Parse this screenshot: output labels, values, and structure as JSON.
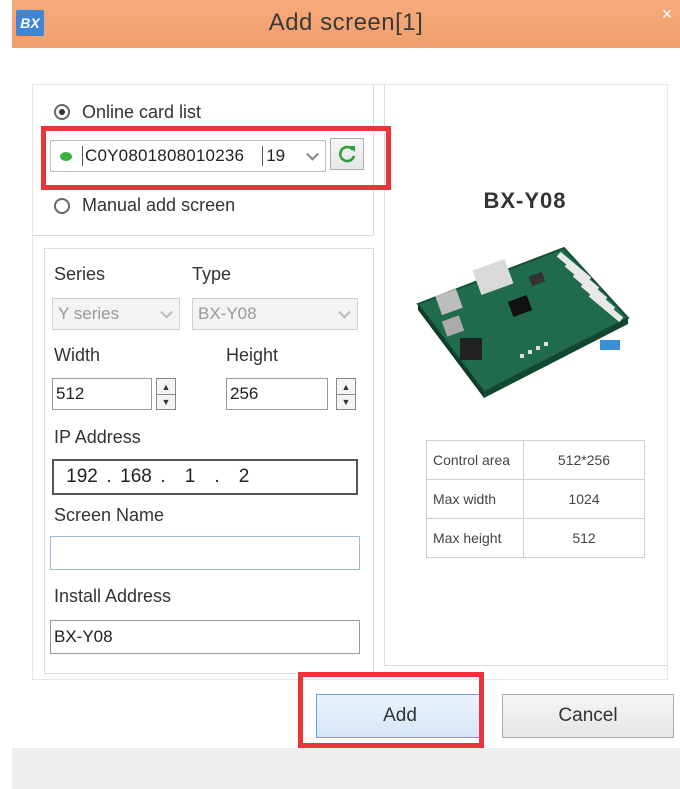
{
  "window": {
    "title": "Add screen[1]",
    "logo_text": "BX",
    "close_glyph": "×",
    "accent_color": "#f09e6d"
  },
  "card_source": {
    "online_label": "Online card list",
    "online_selected": true,
    "card_status_color": "#3cb043",
    "card_id": "C0Y0801808010236",
    "card_suffix": "19",
    "refresh_icon": "refresh-icon",
    "manual_label": "Manual add screen"
  },
  "config": {
    "series_label": "Series",
    "series_value": "Y series",
    "type_label": "Type",
    "type_value": "BX-Y08",
    "width_label": "Width",
    "width_value": "512",
    "height_label": "Height",
    "height_value": "256",
    "ip_label": "IP Address",
    "ip_octets": [
      "192",
      "168",
      "1",
      "2"
    ],
    "screen_name_label": "Screen Name",
    "screen_name_value": "",
    "install_address_label": "Install Address",
    "install_address_value": "BX-Y08"
  },
  "preview": {
    "model": "BX-Y08",
    "specs": [
      {
        "key": "Control area",
        "value": "512*256"
      },
      {
        "key": "Max width",
        "value": "1024"
      },
      {
        "key": "Max height",
        "value": "512"
      }
    ]
  },
  "buttons": {
    "add": "Add",
    "cancel": "Cancel"
  },
  "highlight_color": "#e8343a"
}
